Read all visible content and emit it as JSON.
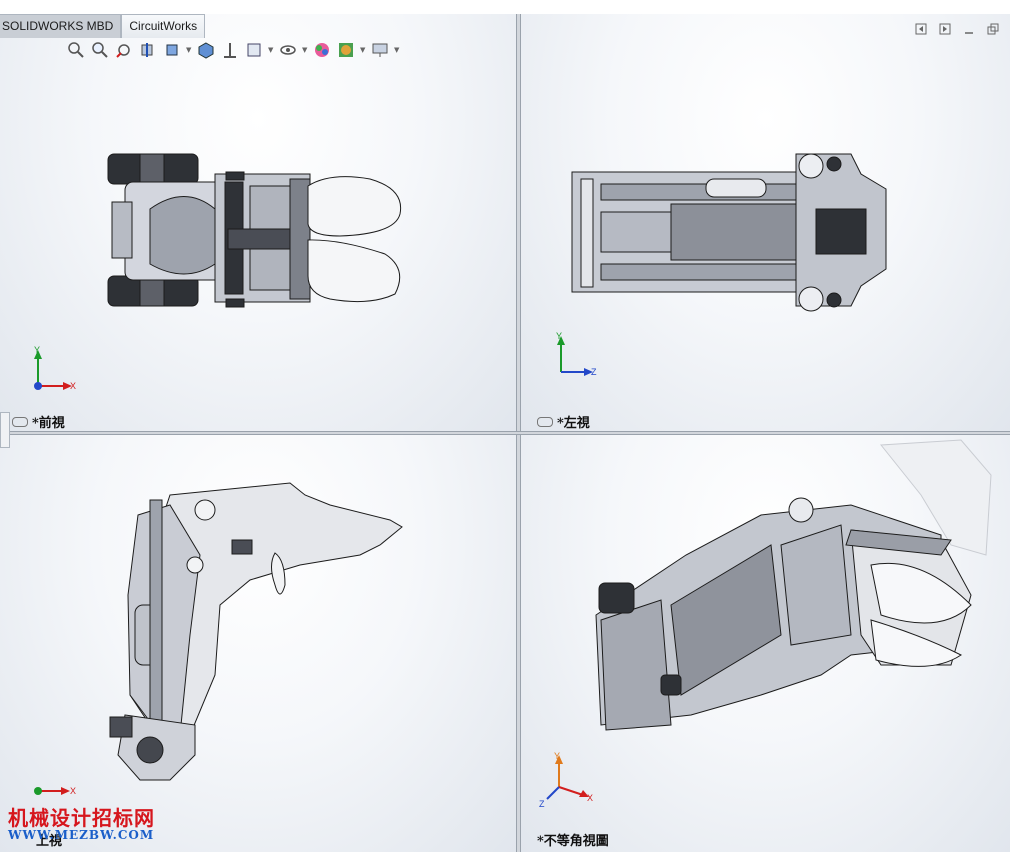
{
  "tabs": [
    "SOLIDWORKS MBD",
    "CircuitWorks"
  ],
  "toolbar": {
    "buttons": [
      "zoom-to-fit-icon",
      "zoom-to-area-icon",
      "previous-view-icon",
      "section-view-icon",
      "view-orientation-icon",
      "display-style-icon",
      "hide-show-items-icon",
      "edit-appearance-icon",
      "apply-scene-icon",
      "view-settings-icon"
    ]
  },
  "window_controls": [
    "tile-left-icon",
    "tile-right-icon",
    "minimize-icon",
    "restore-icon"
  ],
  "viewports": {
    "front": {
      "label": "*前視",
      "triad": [
        "Y",
        "X"
      ]
    },
    "left": {
      "label": "*左視",
      "triad": [
        "Y",
        "Z"
      ]
    },
    "top": {
      "label": "上視",
      "triad": [
        "X"
      ]
    },
    "iso": {
      "label": "*不等角視圖",
      "triad": [
        "Y",
        "Z",
        "X"
      ]
    }
  },
  "watermark": {
    "text": "机械设计招标网",
    "url": "WWW.MEZBW.COM"
  },
  "colors": {
    "accent_red": "#d6161d",
    "accent_blue": "#1a5ec9",
    "part_fill": "#d3d6de",
    "part_stroke": "#1c1c1c"
  }
}
